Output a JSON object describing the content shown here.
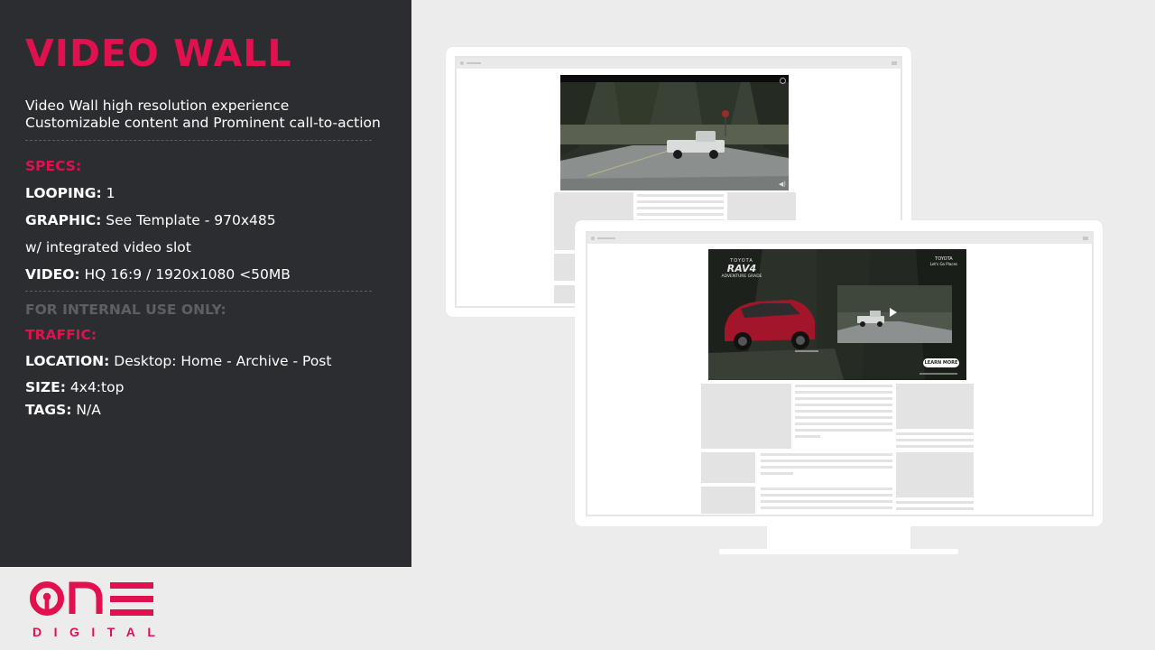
{
  "title": "VIDEO WALL",
  "description": [
    "Video Wall high resolution experience",
    "Customizable content and Prominent call-to-action"
  ],
  "specs": {
    "heading": "SPECS:",
    "looping": {
      "label": "LOOPING:",
      "value": "1"
    },
    "graphic": {
      "label": "GRAPHIC:",
      "value": "See Template - 970x485"
    },
    "graphic_note": "w/ integrated video slot",
    "video": {
      "label": "VIDEO:",
      "value": "HQ 16:9 / 1920x1080 <50MB"
    }
  },
  "internal": "FOR INTERNAL USE ONLY:",
  "traffic": {
    "heading": "TRAFFIC:",
    "location": {
      "label": "LOCATION:",
      "value": "Desktop: Home - Archive - Post"
    },
    "size": {
      "label": "SIZE:",
      "value": "4x4:top"
    },
    "tags": {
      "label": "TAGS:",
      "value": "N/A"
    }
  },
  "ad": {
    "brand": "TOYOTA",
    "model": "RAV4",
    "edition": "ADVENTURE GRADE",
    "logo_text": "TOYOTA",
    "tagline": "Let's Go Places",
    "cta": "LEARN MORE"
  },
  "logo": {
    "word": "ONE",
    "sub": "DIGITAL"
  },
  "colors": {
    "accent": "#e0114e",
    "panel": "#2c2d31",
    "background": "#ececec"
  }
}
